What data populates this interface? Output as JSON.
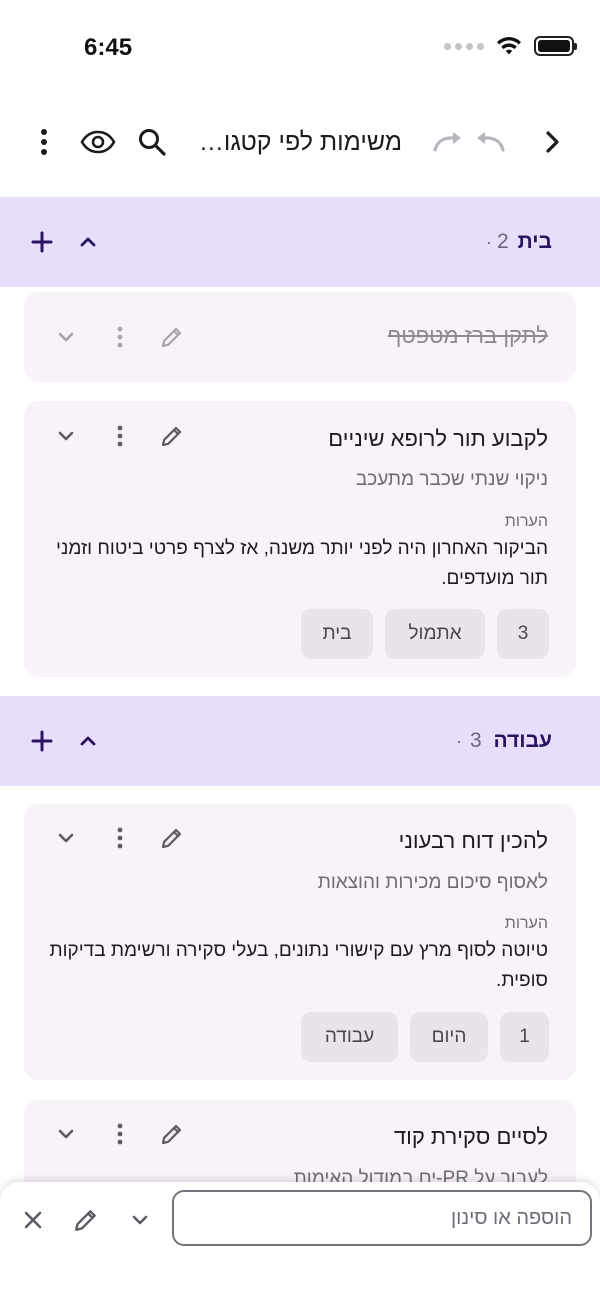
{
  "status_bar": {
    "time": "6:45"
  },
  "app_bar": {
    "title": "משימות לפי קטגוריה",
    "icons": {
      "back": "chevron-right-icon",
      "undo": "undo-icon",
      "redo": "redo-icon",
      "search": "search-icon",
      "view": "eye-icon",
      "menu": "more-vertical-icon"
    }
  },
  "groups": [
    {
      "name": "בית",
      "count": "2",
      "tasks": [
        {
          "title": "לתקן ברז מטפטף",
          "done": true
        },
        {
          "title": "לקבוע תור לרופא שיניים",
          "subtitle": "ניקוי שנתי שכבר מתעכב",
          "notes_label": "הערות",
          "notes": "הביקור האחרון היה לפני יותר משנה, אז לצרף פרטי ביטוח וזמני תור מועדפים.",
          "chips": [
            "3",
            "אתמול",
            "בית"
          ]
        }
      ]
    },
    {
      "name": "עבודה",
      "count": "3",
      "tasks": [
        {
          "title": "להכין דוח רבעוני",
          "subtitle": "לאסוף סיכום מכירות והוצאות",
          "notes_label": "הערות",
          "notes": "טיוטה לסוף מרץ עם קישורי נתונים, בעלי סקירה ורשימת בדיקות סופית.",
          "chips": [
            "1",
            "היום",
            "עבודה"
          ]
        },
        {
          "title": "לסיים סקירת קוד",
          "subtitle": "לעבור על PR-ים במודול האימות"
        }
      ]
    }
  ],
  "bottom_bar": {
    "placeholder": "הוספה או סינון",
    "value": ""
  },
  "colors": {
    "accent": "#e8defc",
    "card": "#f7f3f8",
    "chip": "#e9e4ea",
    "header_text": "#2a1460"
  }
}
